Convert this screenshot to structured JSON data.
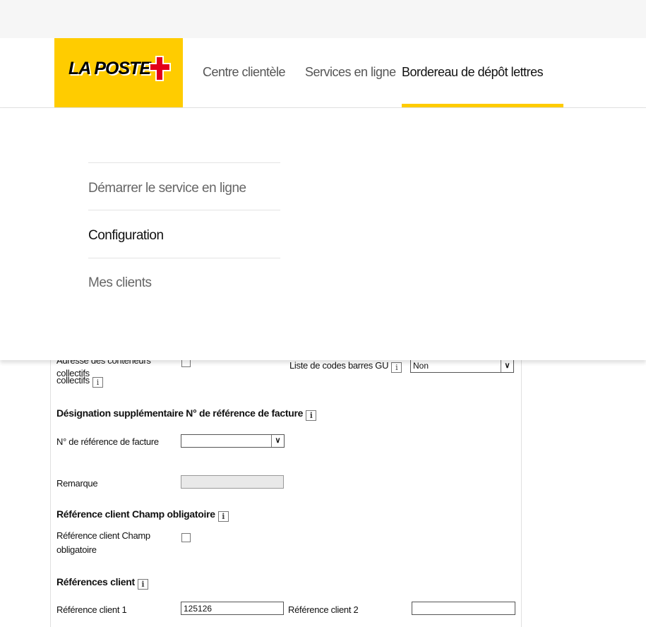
{
  "header": {
    "logo_text": "LA POSTE",
    "nav": {
      "centre": "Centre clientèle",
      "services": "Services en ligne",
      "bordereau": "Bordereau de dépôt lettres"
    }
  },
  "dropdown_menu": {
    "items": [
      {
        "label": "Démarrer le service en ligne"
      },
      {
        "label": "Configuration"
      },
      {
        "label": "Mes clients"
      }
    ]
  },
  "form": {
    "adresse_label": "Adresse des conteneurs collectifs",
    "adresse_label_line2": "collectifs",
    "gu_label": "Liste de codes barres GU",
    "gu_value": "Non",
    "designation_heading": "Désignation supplémentaire N° de référence de facture",
    "facture_label": "N° de référence de facture",
    "facture_value": "",
    "remarque_label": "Remarque",
    "ref_oblig_heading": "Référence client Champ obligatoire",
    "ref_oblig_label_line1": "Référence client Champ",
    "ref_oblig_label_line2": "obligatoire",
    "refs_heading": "Références client",
    "ref1_label": "Référence client 1",
    "ref1_value": "125126",
    "ref2_label": "Référence client 2",
    "ref2_value": ""
  },
  "icons": {
    "info": "info-icon",
    "dropdown_arrow": "chevron-down-icon",
    "logo_cross": "swiss-cross-icon"
  },
  "colors": {
    "brand_yellow": "#ffcc00",
    "text": "#111111"
  }
}
